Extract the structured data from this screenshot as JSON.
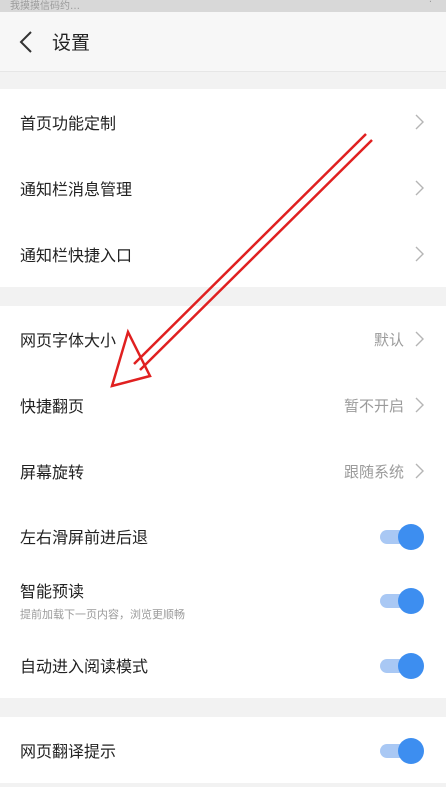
{
  "status_bar": {
    "left_text": "我摸摸信码约…",
    "right_text": "·"
  },
  "header": {
    "title": "设置"
  },
  "groups": [
    {
      "items": [
        {
          "label": "首页功能定制",
          "value": ""
        },
        {
          "label": "通知栏消息管理",
          "value": ""
        },
        {
          "label": "通知栏快捷入口",
          "value": ""
        }
      ]
    },
    {
      "items": [
        {
          "label": "网页字体大小",
          "value": "默认"
        },
        {
          "label": "快捷翻页",
          "value": "暂不开启"
        },
        {
          "label": "屏幕旋转",
          "value": "跟随系统"
        },
        {
          "label": "左右滑屏前进后退",
          "toggle": true
        },
        {
          "label": "智能预读",
          "sub": "提前加载下一页内容，浏览更顺畅",
          "toggle": true
        },
        {
          "label": "自动进入阅读模式",
          "toggle": true
        }
      ]
    },
    {
      "items": [
        {
          "label": "网页翻译提示",
          "toggle": true
        }
      ]
    }
  ],
  "colors": {
    "accent": "#3d8ef0",
    "annotation_arrow": "#e02020"
  }
}
